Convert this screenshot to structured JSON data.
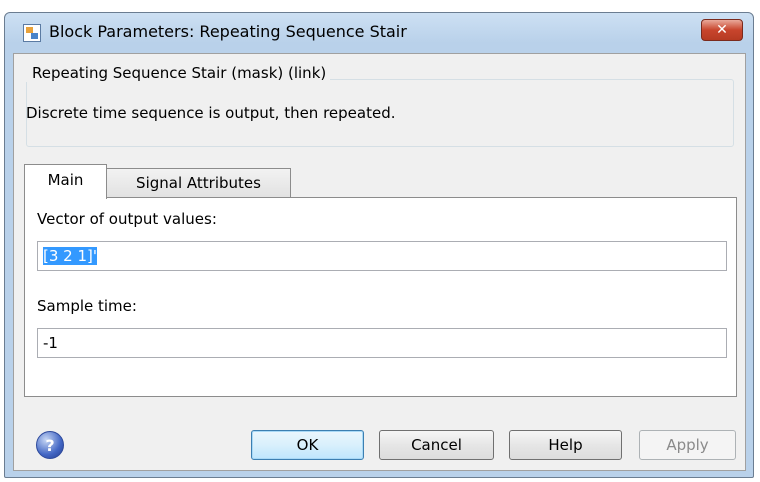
{
  "window": {
    "title": "Block Parameters: Repeating Sequence Stair",
    "close_glyph": "✕"
  },
  "description_group": {
    "label": "Repeating Sequence Stair (mask) (link)",
    "text": "Discrete time sequence is output, then repeated."
  },
  "tabs": [
    {
      "label": "Main",
      "active": true
    },
    {
      "label": "Signal Attributes",
      "active": false
    }
  ],
  "fields": {
    "output_values": {
      "label": "Vector of output values:",
      "value": "[3 2 1]'"
    },
    "sample_time": {
      "label": "Sample time:",
      "value": "-1"
    }
  },
  "buttons": {
    "ok": "OK",
    "cancel": "Cancel",
    "help": "Help",
    "apply": "Apply"
  },
  "help_icon_glyph": "?",
  "icons": {
    "app": "simulink-block-icon",
    "help": "help-question-icon",
    "close": "close-icon"
  }
}
